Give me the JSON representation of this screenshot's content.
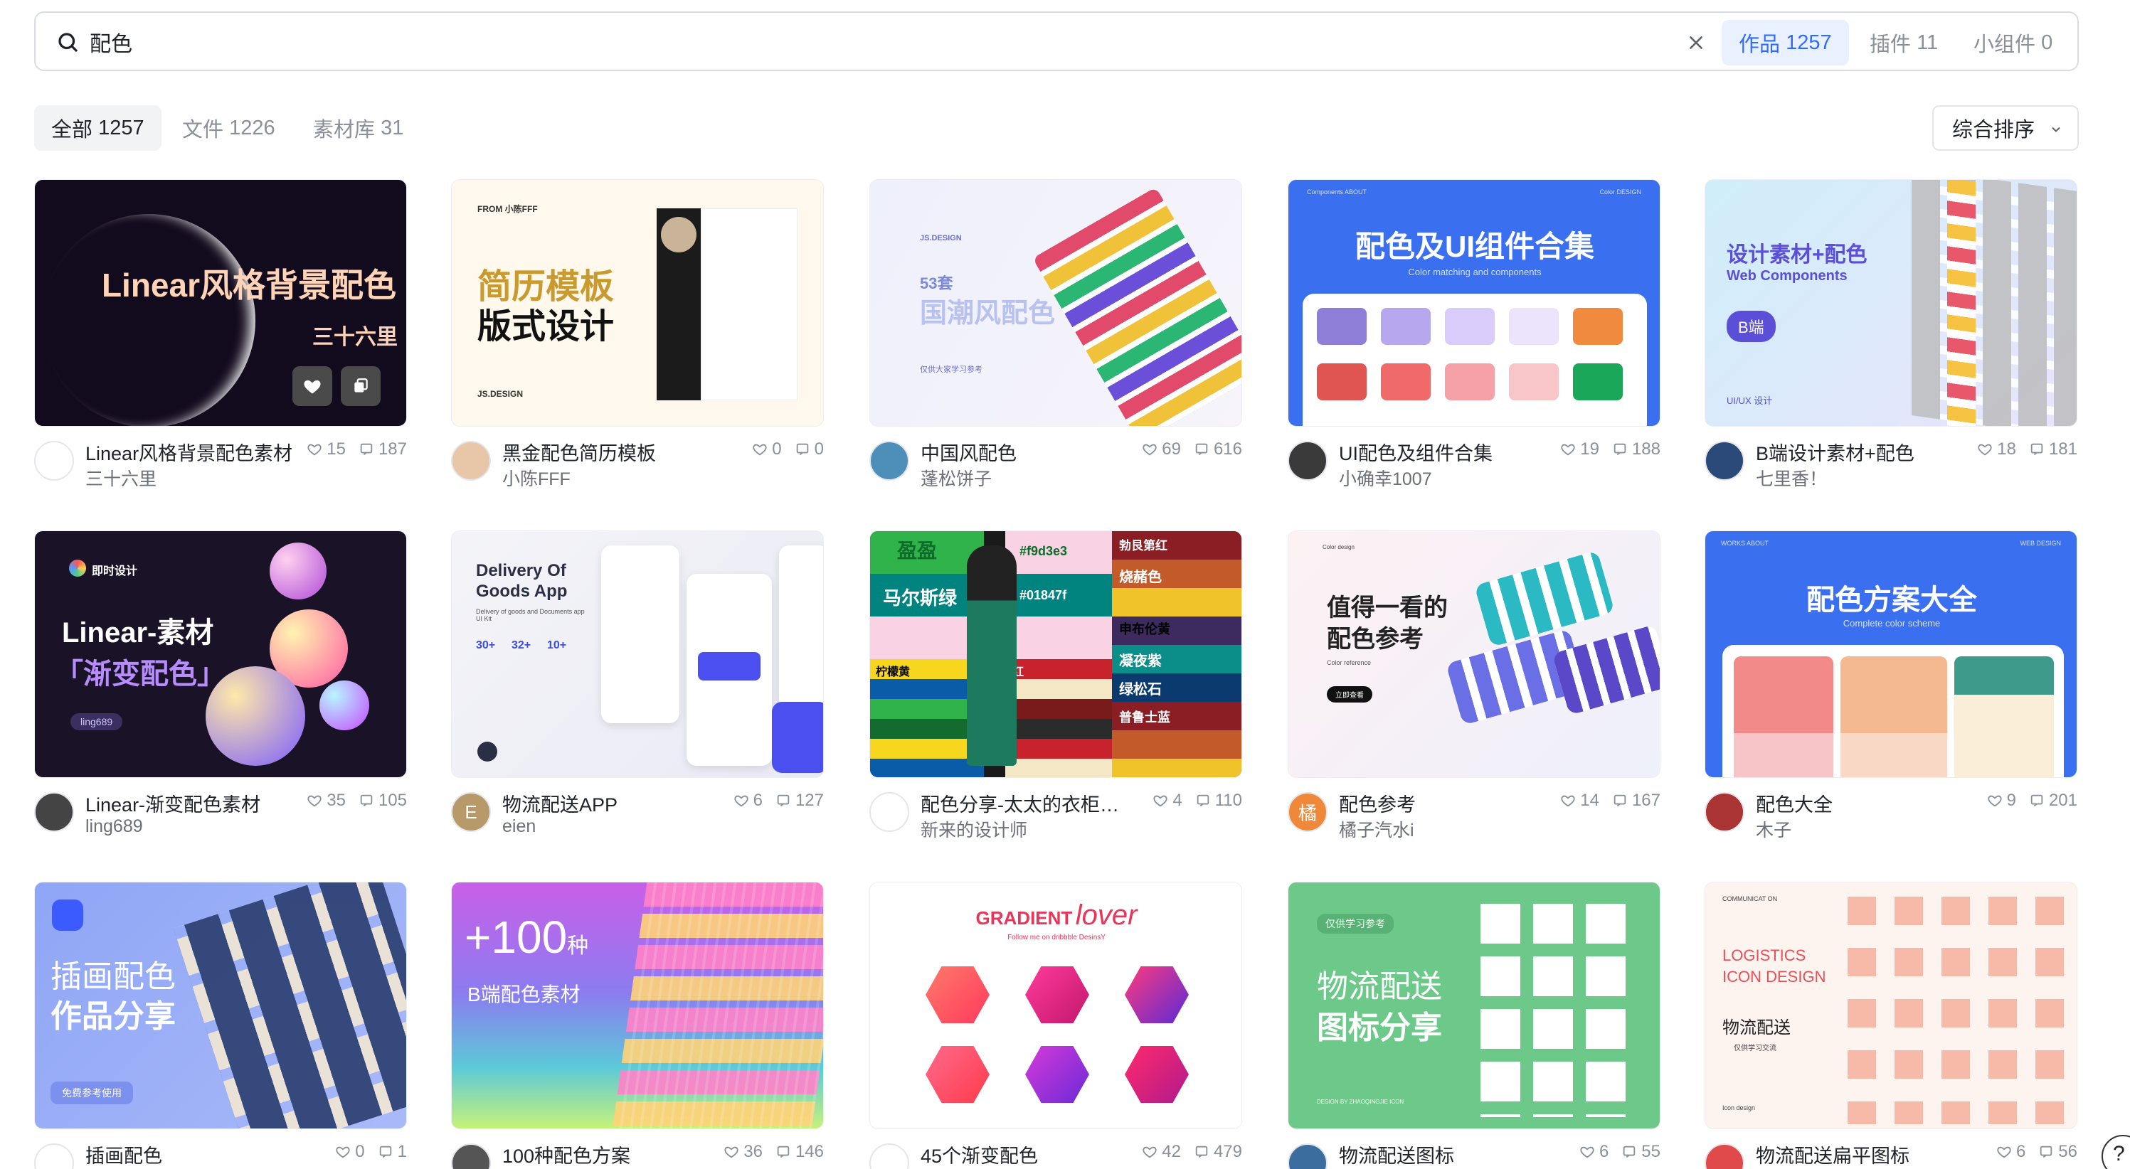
{
  "search": {
    "value": "配色",
    "type_tabs": [
      {
        "label": "作品",
        "count": "1257"
      },
      {
        "label": "插件",
        "count": "11"
      },
      {
        "label": "小组件",
        "count": "0"
      }
    ]
  },
  "filters": {
    "tabs": [
      {
        "label": "全部",
        "count": "1257"
      },
      {
        "label": "文件",
        "count": "1226"
      },
      {
        "label": "素材库",
        "count": "31"
      }
    ],
    "sort_label": "综合排序"
  },
  "colors": {
    "accent": "#2f6bff",
    "accent_bg": "#e9f1ff"
  },
  "cards": [
    {
      "title": "Linear风格背景配色素材",
      "author": "三十六里",
      "likes": "15",
      "comments": "187",
      "thumb": {
        "title": "Linear风格背景配色",
        "subtitle": "三十六里"
      }
    },
    {
      "title": "黑金配色简历模板",
      "author": "小陈FFF",
      "likes": "0",
      "comments": "0",
      "thumb": {
        "top": "FROM 小陈FFF",
        "line1": "简历模板",
        "line2": "版式设计",
        "foot": "JS.DESIGN"
      }
    },
    {
      "title": "中国风配色",
      "author": "蓬松饼子",
      "likes": "69",
      "comments": "616",
      "thumb": {
        "tag": "JS.DESIGN",
        "line1": "53套",
        "line2": "国潮风配色",
        "foot": "仅供大家学习参考"
      }
    },
    {
      "title": "UI配色及组件合集",
      "author": "小确幸1007",
      "likes": "19",
      "comments": "188",
      "thumb": {
        "nav1": "Components  ABOUT",
        "nav2": "Color   DESIGN",
        "title": "配色及UI组件合集",
        "subtitle": "Color matching and components"
      }
    },
    {
      "title": "B端设计素材+配色",
      "author": "七里香！",
      "likes": "18",
      "comments": "181",
      "thumb": {
        "title": "设计素材+配色",
        "subtitle": "Web Components",
        "badge": "B端",
        "foot": "UI/UX 设计"
      }
    },
    {
      "title": "Linear-渐变配色素材",
      "author": "ling689",
      "likes": "35",
      "comments": "105",
      "thumb": {
        "brand": "即时设计",
        "line1": "Linear-素材",
        "line2": "「渐变配色」",
        "tag": "ling689"
      }
    },
    {
      "title": "物流配送APP",
      "author": "eien",
      "likes": "6",
      "comments": "127",
      "thumb": {
        "title": "Delivery Of Goods App",
        "desc": "Delivery of goods and Documents app UI Kit",
        "s1": "30+",
        "s2": "32+",
        "s3": "10+"
      }
    },
    {
      "title": "配色分享-太太的衣柜【...",
      "author": "新来的设计师",
      "likes": "4",
      "comments": "110",
      "thumb": {
        "n1": "盈盈",
        "n2": "马尔斯绿",
        "n3": "#f9d3e3",
        "n4": "#01847f",
        "n5": "勃艮第红",
        "n6": "烧赭色",
        "n7": "申布伦黄",
        "n8": "凝夜紫",
        "n9": "绿松石",
        "n10": "普鲁士蓝",
        "n11": "柠檬黄",
        "n12": "提香红"
      }
    },
    {
      "title": "配色参考",
      "author": "橘子汽水i",
      "likes": "14",
      "comments": "167",
      "thumb": {
        "top": "Color design",
        "line1": "值得一看的",
        "line2": "配色参考",
        "sub": "Color reference",
        "btn": "立即查看"
      }
    },
    {
      "title": "配色大全",
      "author": "木子",
      "likes": "9",
      "comments": "201",
      "thumb": {
        "nav1": "WORKS   ABOUT",
        "nav2": "WEB   DESIGN",
        "title": "配色方案大全",
        "subtitle": "Complete color scheme"
      }
    },
    {
      "title": "插画配色",
      "author": "",
      "likes": "0",
      "comments": "1",
      "thumb": {
        "line1": "插画配色",
        "line2": "作品分享",
        "btn": "免费参考使用"
      }
    },
    {
      "title": "100种配色方案",
      "author": "",
      "likes": "36",
      "comments": "146",
      "thumb": {
        "big": "+100",
        "unit": "种",
        "sub": "B端配色素材"
      }
    },
    {
      "title": "45个渐变配色",
      "author": "",
      "likes": "42",
      "comments": "479",
      "thumb": {
        "t1": "GRADIENT",
        "t2": "lover",
        "sub": "Follow me on dribbble DesinsY"
      }
    },
    {
      "title": "物流配送图标",
      "author": "",
      "likes": "6",
      "comments": "55",
      "thumb": {
        "tag": "仅供学习参考",
        "line1": "物流配送",
        "line2": "图标分享",
        "foot": "DESIGN BY ZHAOQINGJIE ICON"
      }
    },
    {
      "title": "物流配送扁平图标",
      "author": "",
      "likes": "6",
      "comments": "56",
      "thumb": {
        "top": "COMMUNICAT ON",
        "l1": "LOGISTICS",
        "l2": "ICON DESIGN",
        "l3": "物流配送",
        "l4": "仅供学习交流",
        "foot": "Icon design"
      }
    }
  ],
  "help": "?"
}
